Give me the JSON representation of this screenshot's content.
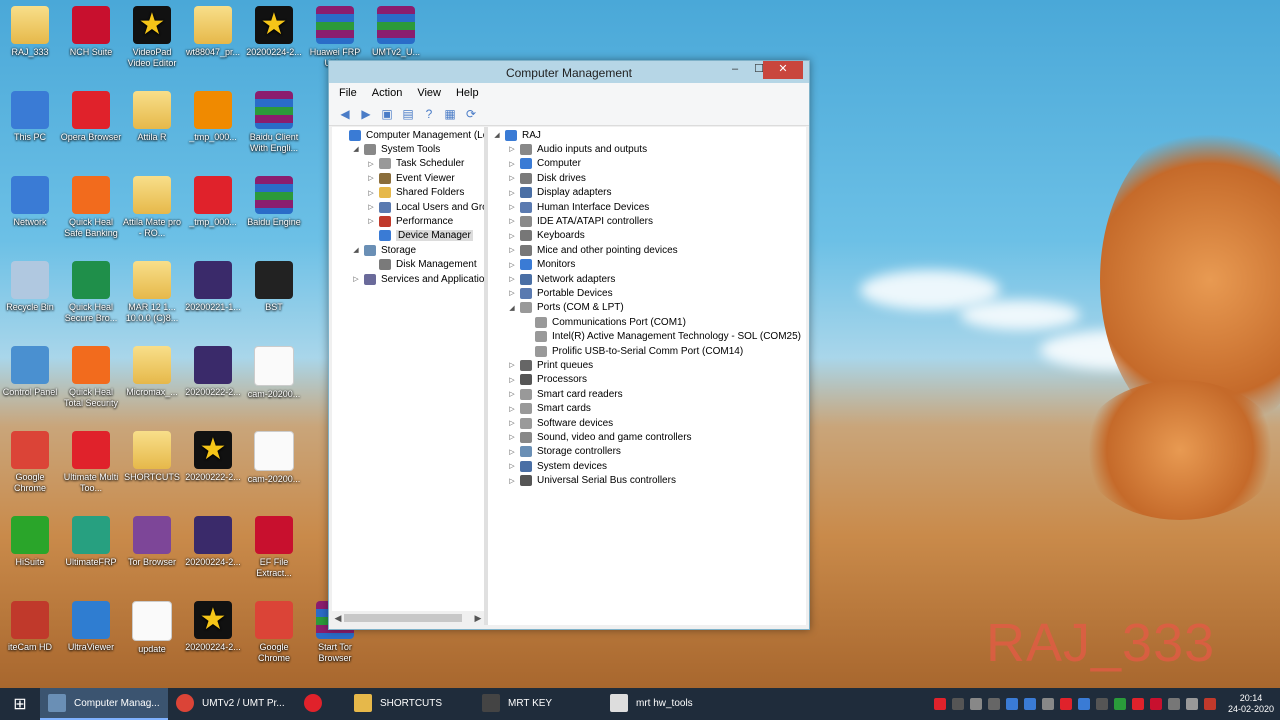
{
  "desktop": {
    "watermark": "RAJ_333",
    "icons": [
      {
        "label": "RAJ_333",
        "kind": "folder",
        "col": 0,
        "row": 0
      },
      {
        "label": "NCH Suite",
        "kind": "nch",
        "col": 1,
        "row": 0
      },
      {
        "label": "VideoPad Video Editor",
        "kind": "star",
        "col": 2,
        "row": 0
      },
      {
        "label": "wt88047_pr...",
        "kind": "folder",
        "col": 3,
        "row": 0
      },
      {
        "label": "20200224-2...",
        "kind": "star",
        "col": 4,
        "row": 0
      },
      {
        "label": "Huawei FRP Unl...",
        "kind": "winrar",
        "col": 5,
        "row": 0
      },
      {
        "label": "UMTv2_U...",
        "kind": "winrar",
        "col": 6,
        "row": 0
      },
      {
        "label": "This PC",
        "kind": "pc",
        "col": 0,
        "row": 1
      },
      {
        "label": "Opera Browser",
        "kind": "opera",
        "col": 1,
        "row": 1
      },
      {
        "label": "Attila R",
        "kind": "folder",
        "col": 2,
        "row": 1
      },
      {
        "label": "_tmp_000...",
        "kind": "vlc",
        "col": 3,
        "row": 1
      },
      {
        "label": "Baidu Client With Engli...",
        "kind": "winrar",
        "col": 4,
        "row": 1
      },
      {
        "label": "Network",
        "kind": "network",
        "col": 0,
        "row": 2
      },
      {
        "label": "Quick Heal Safe Banking",
        "kind": "qh",
        "col": 1,
        "row": 2
      },
      {
        "label": "Attila Mate pro - RO...",
        "kind": "folder",
        "col": 2,
        "row": 2
      },
      {
        "label": "_tmp_000...",
        "kind": "music",
        "col": 3,
        "row": 2
      },
      {
        "label": "Baidu Engine",
        "kind": "winrar",
        "col": 4,
        "row": 2
      },
      {
        "label": "Recycle Bin",
        "kind": "bin",
        "col": 0,
        "row": 3
      },
      {
        "label": "Quick Heal Secure Bro...",
        "kind": "qhsecure",
        "col": 1,
        "row": 3
      },
      {
        "label": "MAR 12 1... 10.0.0 (C)8...",
        "kind": "folder",
        "col": 2,
        "row": 3
      },
      {
        "label": "20200221-1...",
        "kind": "video",
        "col": 3,
        "row": 3
      },
      {
        "label": "BST",
        "kind": "bst",
        "col": 4,
        "row": 3
      },
      {
        "label": "Control Panel",
        "kind": "cp",
        "col": 0,
        "row": 4
      },
      {
        "label": "Quick Heal Total Security",
        "kind": "qhtotal",
        "col": 1,
        "row": 4
      },
      {
        "label": "Micromax_...",
        "kind": "folder",
        "col": 2,
        "row": 4
      },
      {
        "label": "20200222-2...",
        "kind": "video",
        "col": 3,
        "row": 4
      },
      {
        "label": "cam-20200...",
        "kind": "doc",
        "col": 4,
        "row": 4
      },
      {
        "label": "Google Chrome",
        "kind": "chrome",
        "col": 0,
        "row": 5
      },
      {
        "label": "Ultimate Multi Too...",
        "kind": "umt",
        "col": 1,
        "row": 5
      },
      {
        "label": "SHORTCUTS",
        "kind": "folder",
        "col": 2,
        "row": 5
      },
      {
        "label": "20200222-2...",
        "kind": "star",
        "col": 3,
        "row": 5
      },
      {
        "label": "cam-20200...",
        "kind": "doc",
        "col": 4,
        "row": 5
      },
      {
        "label": "HiSuite",
        "kind": "hisuite",
        "col": 0,
        "row": 6
      },
      {
        "label": "UltimateFRP",
        "kind": "ufrp",
        "col": 1,
        "row": 6
      },
      {
        "label": "Tor Browser",
        "kind": "tor",
        "col": 2,
        "row": 6
      },
      {
        "label": "20200224-2...",
        "kind": "video",
        "col": 3,
        "row": 6
      },
      {
        "label": "EF File Extract...",
        "kind": "ef",
        "col": 4,
        "row": 6
      },
      {
        "label": "iteCam HD",
        "kind": "cam",
        "col": 0,
        "row": 7
      },
      {
        "label": "UltraViewer",
        "kind": "uv",
        "col": 1,
        "row": 7
      },
      {
        "label": "update",
        "kind": "doc",
        "col": 2,
        "row": 7
      },
      {
        "label": "20200224-2...",
        "kind": "star",
        "col": 3,
        "row": 7
      },
      {
        "label": "Google Chrome",
        "kind": "chrome",
        "col": 4,
        "row": 7
      },
      {
        "label": "Start Tor Browser",
        "kind": "winrar",
        "col": 5,
        "row": 7
      }
    ]
  },
  "window": {
    "title": "Computer Management",
    "buttons": {
      "minimize": "–",
      "maximize": "☐",
      "close": "✕"
    },
    "menu": [
      "File",
      "Action",
      "View",
      "Help"
    ],
    "toolbar": [
      "back",
      "forward",
      "up-folder",
      "show-hide",
      "help",
      "properties",
      "scan"
    ],
    "left_tree": [
      {
        "label": "Computer Management (Local",
        "indent": 0,
        "expander": "",
        "icon": "computer"
      },
      {
        "label": "System Tools",
        "indent": 1,
        "expander": "◢",
        "icon": "tools"
      },
      {
        "label": "Task Scheduler",
        "indent": 2,
        "expander": "▷",
        "icon": "clock"
      },
      {
        "label": "Event Viewer",
        "indent": 2,
        "expander": "▷",
        "icon": "log"
      },
      {
        "label": "Shared Folders",
        "indent": 2,
        "expander": "▷",
        "icon": "folder"
      },
      {
        "label": "Local Users and Groups",
        "indent": 2,
        "expander": "▷",
        "icon": "users"
      },
      {
        "label": "Performance",
        "indent": 2,
        "expander": "▷",
        "icon": "perf"
      },
      {
        "label": "Device Manager",
        "indent": 2,
        "expander": "",
        "icon": "devmgr",
        "selected": true
      },
      {
        "label": "Storage",
        "indent": 1,
        "expander": "◢",
        "icon": "storage"
      },
      {
        "label": "Disk Management",
        "indent": 2,
        "expander": "",
        "icon": "disk"
      },
      {
        "label": "Services and Applications",
        "indent": 1,
        "expander": "▷",
        "icon": "services"
      }
    ],
    "right_tree": [
      {
        "label": "RAJ",
        "indent": 0,
        "expander": "◢",
        "icon": "computer"
      },
      {
        "label": "Audio inputs and outputs",
        "indent": 1,
        "expander": "▷",
        "icon": "audio"
      },
      {
        "label": "Computer",
        "indent": 1,
        "expander": "▷",
        "icon": "computer"
      },
      {
        "label": "Disk drives",
        "indent": 1,
        "expander": "▷",
        "icon": "disk"
      },
      {
        "label": "Display adapters",
        "indent": 1,
        "expander": "▷",
        "icon": "display"
      },
      {
        "label": "Human Interface Devices",
        "indent": 1,
        "expander": "▷",
        "icon": "hid"
      },
      {
        "label": "IDE ATA/ATAPI controllers",
        "indent": 1,
        "expander": "▷",
        "icon": "ide"
      },
      {
        "label": "Keyboards",
        "indent": 1,
        "expander": "▷",
        "icon": "keyboard"
      },
      {
        "label": "Mice and other pointing devices",
        "indent": 1,
        "expander": "▷",
        "icon": "mouse"
      },
      {
        "label": "Monitors",
        "indent": 1,
        "expander": "▷",
        "icon": "monitor"
      },
      {
        "label": "Network adapters",
        "indent": 1,
        "expander": "▷",
        "icon": "network"
      },
      {
        "label": "Portable Devices",
        "indent": 1,
        "expander": "▷",
        "icon": "portable"
      },
      {
        "label": "Ports (COM & LPT)",
        "indent": 1,
        "expander": "◢",
        "icon": "port"
      },
      {
        "label": "Communications Port (COM1)",
        "indent": 2,
        "expander": "",
        "icon": "port"
      },
      {
        "label": "Intel(R) Active Management Technology - SOL (COM25)",
        "indent": 2,
        "expander": "",
        "icon": "port"
      },
      {
        "label": "Prolific USB-to-Serial Comm Port (COM14)",
        "indent": 2,
        "expander": "",
        "icon": "port"
      },
      {
        "label": "Print queues",
        "indent": 1,
        "expander": "▷",
        "icon": "printer"
      },
      {
        "label": "Processors",
        "indent": 1,
        "expander": "▷",
        "icon": "cpu"
      },
      {
        "label": "Smart card readers",
        "indent": 1,
        "expander": "▷",
        "icon": "smartcard"
      },
      {
        "label": "Smart cards",
        "indent": 1,
        "expander": "▷",
        "icon": "smartcard"
      },
      {
        "label": "Software devices",
        "indent": 1,
        "expander": "▷",
        "icon": "software"
      },
      {
        "label": "Sound, video and game controllers",
        "indent": 1,
        "expander": "▷",
        "icon": "sound"
      },
      {
        "label": "Storage controllers",
        "indent": 1,
        "expander": "▷",
        "icon": "storage"
      },
      {
        "label": "System devices",
        "indent": 1,
        "expander": "▷",
        "icon": "system"
      },
      {
        "label": "Universal Serial Bus controllers",
        "indent": 1,
        "expander": "▷",
        "icon": "usb"
      }
    ]
  },
  "taskbar": {
    "start_icon": "windows-icon",
    "tasks": [
      {
        "label": "Computer Manag...",
        "icon": "computer-management-icon",
        "active": true
      },
      {
        "label": "UMTv2 / UMT Pr...",
        "icon": "chrome-icon",
        "active": false
      },
      {
        "label": "",
        "icon": "opera-icon",
        "active": false
      },
      {
        "label": "SHORTCUTS",
        "icon": "folder-icon",
        "active": false
      },
      {
        "label": "MRT KEY",
        "icon": "mrt-icon",
        "active": false
      },
      {
        "label": "mrt hw_tools",
        "icon": "tools-icon",
        "active": false
      }
    ],
    "tray_icons": 16,
    "time": "20:14",
    "date": "24-02-2020"
  }
}
